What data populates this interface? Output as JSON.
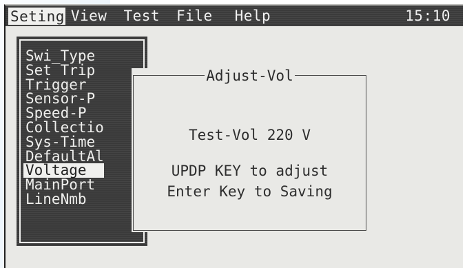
{
  "menubar": {
    "items": [
      "Seting",
      "View",
      "Test",
      "File",
      "Help"
    ],
    "active_index": 0,
    "clock": "15:10"
  },
  "side_menu": {
    "items": [
      "Swi_Type",
      "Set Trip",
      "Trigger",
      "Sensor-P",
      "Speed-P",
      "Collectio",
      "Sys-Time",
      "DefaultAl",
      "Voltage",
      "MainPort",
      "LineNmb"
    ],
    "selected_index": 8
  },
  "dialog": {
    "title": "Adjust-Vol",
    "value_line": "Test-Vol 220 V",
    "hint_adjust": "UPDP KEY to adjust",
    "hint_save": "Enter Key to Saving"
  },
  "colors": {
    "lcd_bg": "#e9e9e6",
    "inverse_bg": "#3a3a3a",
    "text_light": "#f0f0ee",
    "text_dark": "#2b2b2b"
  }
}
